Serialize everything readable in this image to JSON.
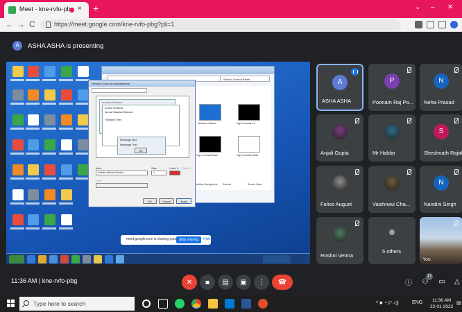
{
  "browser": {
    "tab_title": "Meet - kne-rvfo-pbg",
    "tab_close": "×",
    "new_tab": "+",
    "minimize": "⌄",
    "restore": "–",
    "close": "✕",
    "url": "https://meet.google.com/kne-rvfo-pbg?pli=1",
    "back": "←",
    "forward": "→",
    "reload": "C"
  },
  "presenting": {
    "avatar_letter": "A",
    "text": "ASHA ASHA is presenting"
  },
  "shared_screen": {
    "notification_text": "meet.google.com is sharing your screen.",
    "stop_sharing": "Stop sharing",
    "hide": "Hide",
    "window_title": "Window Color and Appearance",
    "inactive_window": "Inactive Window",
    "active_window": "Active Window",
    "menu_items": "Normal  Disabled  Selected",
    "window_text": "Window Text",
    "message_box": "Message Box",
    "message_text": "Message Text",
    "ok_small": "OK",
    "item_label": "Item:",
    "item_value": "Inactive Window Border",
    "size_label": "Size:",
    "size_value": "1",
    "color1_label": "Color 1:",
    "color2_label": "Color 2:",
    "font_label": "Font:",
    "btn_ok": "OK",
    "btn_cancel": "Cancel",
    "btn_apply": "Apply",
    "search_placeholder": "Search Control Panel",
    "themes": [
      "Windows Classic",
      "High Contrast #1",
      "High Contrast Black",
      "High Contrast White"
    ],
    "bottom_items": [
      "Desktop Background",
      "Sounds",
      "Screen Saver"
    ]
  },
  "participants": [
    {
      "name": "ASHA ASHA",
      "initial": "A",
      "color": "#5b7bd5",
      "type": "initial",
      "speaking": true
    },
    {
      "name": "Poonam Raj Po...",
      "initial": "P",
      "color": "#7b3fb0",
      "type": "initial"
    },
    {
      "name": "Neha Prasad",
      "initial": "N",
      "color": "#1565c0",
      "type": "initial"
    },
    {
      "name": "Anjali Gupta",
      "type": "photo",
      "color": "#7a3b7e"
    },
    {
      "name": "Mr Haldar",
      "type": "photo",
      "color": "#2d6f8a"
    },
    {
      "name": "Sheshnath Rajak",
      "initial": "S",
      "color": "#c2185b",
      "type": "initial"
    },
    {
      "name": "Felice August",
      "type": "photo",
      "color": "#8d8d8d"
    },
    {
      "name": "Vaishnavi Cha...",
      "type": "photo",
      "color": "#6d5a3e"
    },
    {
      "name": "Nandini Singh",
      "initial": "N",
      "color": "#1565c0",
      "type": "initial"
    },
    {
      "name": "Roshni Verma",
      "type": "photo",
      "color": "#4e7a62"
    },
    {
      "name": "5 others",
      "type": "others"
    },
    {
      "name": "You",
      "type": "video"
    }
  ],
  "meetbar": {
    "time_meeting": "11:36 AM  |  kne-rvfo-pbg",
    "participant_count": "17"
  },
  "taskbar": {
    "search_placeholder": "Type here to search",
    "tray_lang": "ENG",
    "clock_time": "11:36 AM",
    "clock_date": "22-01-2022"
  }
}
